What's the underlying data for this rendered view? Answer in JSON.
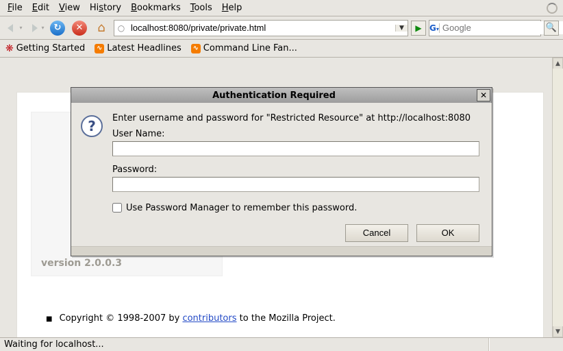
{
  "menu": {
    "file": "File",
    "edit": "Edit",
    "view": "View",
    "history": "History",
    "bookmarks": "Bookmarks",
    "tools": "Tools",
    "help": "Help"
  },
  "toolbar": {
    "url": "localhost:8080/private/private.html",
    "search_placeholder": "Google",
    "search_engine_label": "G"
  },
  "bookmarks": {
    "items": [
      {
        "label": "Getting Started",
        "icon": "paw"
      },
      {
        "label": "Latest Headlines",
        "icon": "rss"
      },
      {
        "label": "Command Line Fan...",
        "icon": "rss"
      }
    ]
  },
  "page": {
    "version": "version 2.0.0.3",
    "copyright_prefix": "Copyright © 1998-2007 by ",
    "copyright_link": "contributors",
    "copyright_suffix": " to the Mozilla Project."
  },
  "statusbar": {
    "message": "Waiting for localhost..."
  },
  "dialog": {
    "title": "Authentication Required",
    "message": "Enter username and password for \"Restricted Resource\" at http://localhost:8080",
    "username_label": "User Name:",
    "username_value": "",
    "password_label": "Password:",
    "password_value": "",
    "remember_label": "Use Password Manager to remember this password.",
    "remember_checked": false,
    "cancel": "Cancel",
    "ok": "OK"
  }
}
